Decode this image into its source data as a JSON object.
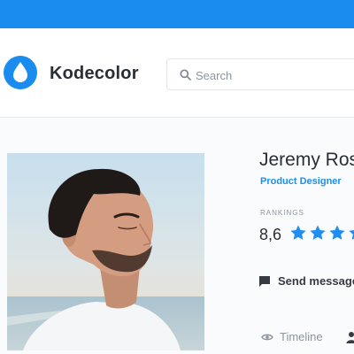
{
  "brand": {
    "name": "Kodecolor",
    "accent_color": "#1a8cf0",
    "logo_icon": "water-drop-icon"
  },
  "search": {
    "placeholder": "Search",
    "value": "",
    "icon": "search-icon"
  },
  "profile": {
    "name": "Jeremy Ros",
    "role": "Product Designer",
    "rankings_label": "RANKINGS",
    "rating": "8,6",
    "stars_visible": 4,
    "send_message_label": "Send message",
    "send_message_icon": "chat-bubble-icon"
  },
  "tabs": [
    {
      "label": "Timeline",
      "icon": "eye-icon"
    },
    {
      "label": "",
      "icon": "user-icon"
    }
  ]
}
